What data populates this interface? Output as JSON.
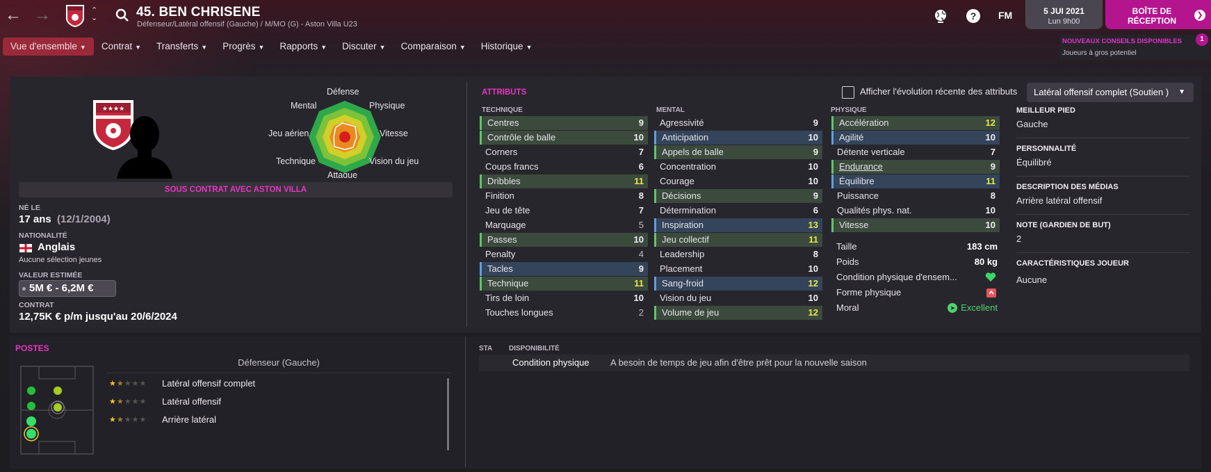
{
  "player": {
    "title": "45. BEN CHRISENE",
    "subtitle": "Défenseur/Latéral offensif (Gauche) / M/MO (G) - Aston Villa U23"
  },
  "topbar": {
    "fm_label": "FM",
    "date": "5 JUI 2021",
    "time": "Lun 9h00",
    "inbox_label": "BOÎTE DE RÉCEPTION"
  },
  "menu": [
    {
      "label": "Vue d'ensemble"
    },
    {
      "label": "Contrat"
    },
    {
      "label": "Transferts"
    },
    {
      "label": "Progrès"
    },
    {
      "label": "Rapports"
    },
    {
      "label": "Discuter"
    },
    {
      "label": "Comparaison"
    },
    {
      "label": "Historique"
    }
  ],
  "advice": {
    "title": "NOUVEAUX CONSEILS DISPONIBLES",
    "text": "Joueurs à gros potentiel",
    "count": "1"
  },
  "radar_labels": {
    "defense": "Défense",
    "mental": "Mental",
    "physique": "Physique",
    "jeu_aerien": "Jeu aérien",
    "vitesse": "Vitesse",
    "technique": "Technique",
    "vision": "Vision du jeu",
    "attaque": "Attaque"
  },
  "profile": {
    "contract_status": "SOUS CONTRAT AVEC ASTON VILLA",
    "born_label": "NÉ LE",
    "age": "17 ans",
    "birthdate": "(12/1/2004)",
    "nationality_label": "NATIONALITÉ",
    "nationality": "Anglais",
    "caps": "Aucune sélection jeunes",
    "value_label": "VALEUR ESTIMÉE",
    "value": "5M € - 6,2M €",
    "contract_label": "CONTRAT",
    "contract": "12,75K € p/m jusqu'au 20/6/2024"
  },
  "attributes": {
    "title": "ATTRIBUTS",
    "show_evolution_label": "Afficher l'évolution récente des attributs",
    "role": "Latéral offensif complet (Soutien )",
    "technique_header": "TECHNIQUE",
    "mental_header": "MENTAL",
    "physique_header": "PHYSIQUE",
    "technique": [
      {
        "name": "Centres",
        "value": "9",
        "hl": "g"
      },
      {
        "name": "Contrôle de balle",
        "value": "10",
        "hl": "g"
      },
      {
        "name": "Corners",
        "value": "7",
        "hl": ""
      },
      {
        "name": "Coups francs",
        "value": "6",
        "hl": ""
      },
      {
        "name": "Dribbles",
        "value": "11",
        "hl": "g",
        "y": true
      },
      {
        "name": "Finition",
        "value": "8",
        "hl": ""
      },
      {
        "name": "Jeu de tête",
        "value": "7",
        "hl": ""
      },
      {
        "name": "Marquage",
        "value": "5",
        "hl": "",
        "grey": true
      },
      {
        "name": "Passes",
        "value": "10",
        "hl": "g"
      },
      {
        "name": "Penalty",
        "value": "4",
        "hl": "",
        "grey": true
      },
      {
        "name": "Tacles",
        "value": "9",
        "hl": "b"
      },
      {
        "name": "Technique",
        "value": "11",
        "hl": "g",
        "y": true
      },
      {
        "name": "Tirs de loin",
        "value": "10",
        "hl": ""
      },
      {
        "name": "Touches longues",
        "value": "2",
        "hl": "",
        "grey": true
      }
    ],
    "mental": [
      {
        "name": "Agressivité",
        "value": "9",
        "hl": ""
      },
      {
        "name": "Anticipation",
        "value": "10",
        "hl": "b"
      },
      {
        "name": "Appels de balle",
        "value": "9",
        "hl": "g"
      },
      {
        "name": "Concentration",
        "value": "10",
        "hl": ""
      },
      {
        "name": "Courage",
        "value": "10",
        "hl": ""
      },
      {
        "name": "Décisions",
        "value": "9",
        "hl": "g"
      },
      {
        "name": "Détermination",
        "value": "6",
        "hl": ""
      },
      {
        "name": "Inspiration",
        "value": "13",
        "hl": "b",
        "y": true
      },
      {
        "name": "Jeu collectif",
        "value": "11",
        "hl": "g",
        "y": true
      },
      {
        "name": "Leadership",
        "value": "8",
        "hl": ""
      },
      {
        "name": "Placement",
        "value": "10",
        "hl": ""
      },
      {
        "name": "Sang-froid",
        "value": "12",
        "hl": "b",
        "y": true
      },
      {
        "name": "Vision du jeu",
        "value": "10",
        "hl": ""
      },
      {
        "name": "Volume de jeu",
        "value": "12",
        "hl": "g",
        "y": true
      }
    ],
    "physique": [
      {
        "name": "Accélération",
        "value": "12",
        "hl": "g",
        "y": true
      },
      {
        "name": "Agilité",
        "value": "10",
        "hl": "b"
      },
      {
        "name": "Détente verticale",
        "value": "7",
        "hl": ""
      },
      {
        "name": "Endurance",
        "value": "9",
        "hl": "g"
      },
      {
        "name": "Équilibre",
        "value": "11",
        "hl": "b",
        "y": true
      },
      {
        "name": "Puissance",
        "value": "8",
        "hl": ""
      },
      {
        "name": "Qualités phys. nat.",
        "value": "10",
        "hl": ""
      },
      {
        "name": "Vitesse",
        "value": "10",
        "hl": "g"
      }
    ],
    "physical_info": [
      {
        "name": "Taille",
        "value": "183 cm"
      },
      {
        "name": "Poids",
        "value": "80 kg"
      },
      {
        "name": "Condition physique d'ensem...",
        "value": ""
      },
      {
        "name": "Forme physique",
        "value": ""
      },
      {
        "name": "Moral",
        "value": "Excellent"
      }
    ]
  },
  "right_info": {
    "foot_label": "MEILLEUR PIED",
    "foot": "Gauche",
    "personality_label": "PERSONNALITÉ",
    "personality": "Équilibré",
    "media_label": "DESCRIPTION DES MÉDIAS",
    "media": "Arrière latéral offensif",
    "gk_label": "NOTE (GARDIEN DE BUT)",
    "gk": "2",
    "traits_label": "CARACTÉRISTIQUES JOUEUR",
    "traits": "Aucune"
  },
  "positions": {
    "title": "POSTES",
    "selected": "Défenseur (Gauche)",
    "roles": [
      {
        "name": "Latéral offensif complet",
        "stars": 1.5
      },
      {
        "name": "Latéral offensif",
        "stars": 1.5
      },
      {
        "name": "Arrière latéral",
        "stars": 1.5
      }
    ]
  },
  "availability": {
    "sta_label": "STA",
    "dispo_label": "DISPONIBILITÉ",
    "condition_label": "Condition physique",
    "condition_text": "A besoin de temps de jeu afin d'être prêt pour la nouvelle saison"
  },
  "colors": {
    "accent": "#e736c2",
    "inbox": "#b5148f",
    "menu_active": "#9a2a3a",
    "green_hl": "#3b4a3d",
    "blue_hl": "#34445a",
    "highlight_value": "#e8e64c"
  }
}
